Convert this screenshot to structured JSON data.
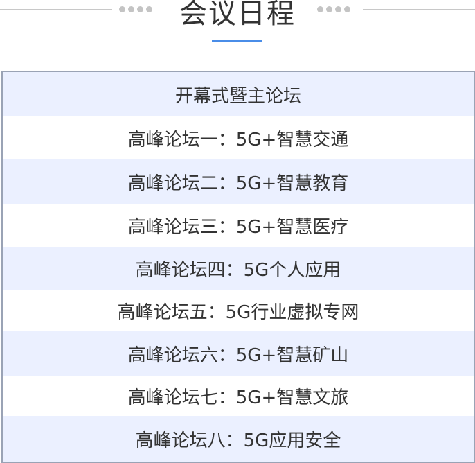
{
  "header": {
    "title": "会议日程"
  },
  "agenda": {
    "items": [
      "开幕式暨主论坛",
      "高峰论坛一：5G+智慧交通",
      "高峰论坛二：5G+智慧教育",
      "高峰论坛三：5G+智慧医疗",
      "高峰论坛四：5G个人应用",
      "高峰论坛五：5G行业虚拟专网",
      "高峰论坛六：5G+智慧矿山",
      "高峰论坛七：5G+智慧文旅",
      "高峰论坛八：5G应用安全"
    ]
  },
  "colors": {
    "row_shade": "#ebf0ff",
    "accent_underline": "#4a8de8",
    "border": "#9aa3b5",
    "text": "#333333"
  }
}
